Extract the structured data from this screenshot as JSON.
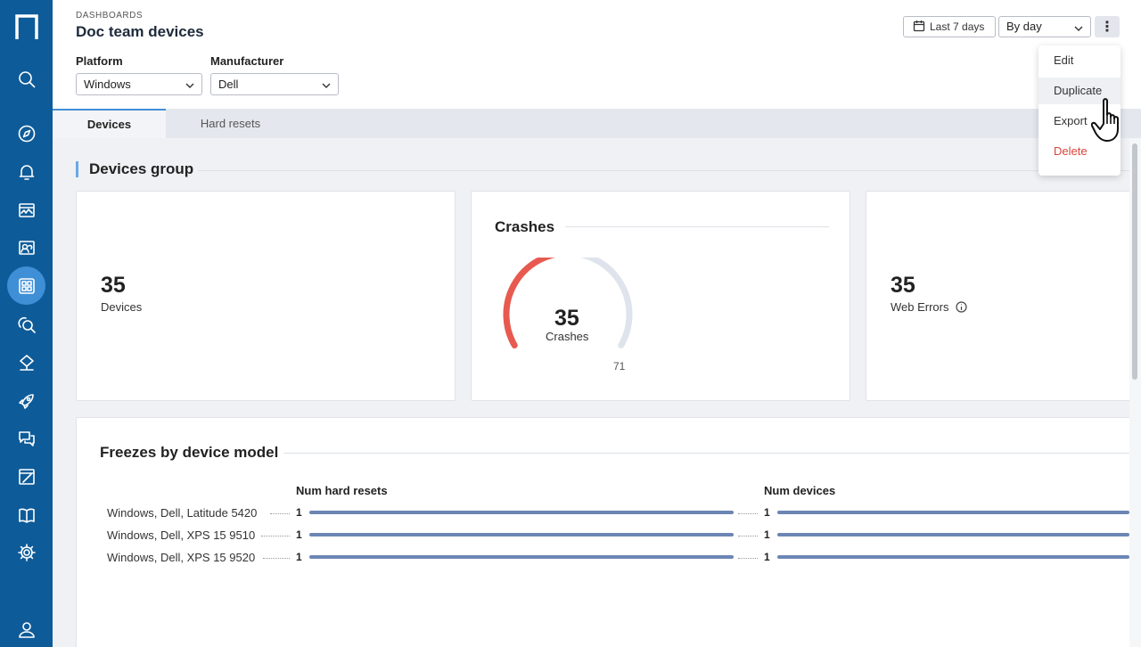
{
  "sidebar": {
    "items": [
      {
        "icon": "search-icon"
      },
      {
        "icon": "compass-icon"
      },
      {
        "icon": "bell-icon"
      },
      {
        "icon": "activity-icon"
      },
      {
        "icon": "users-icon"
      },
      {
        "icon": "dashboard-icon",
        "active": true
      },
      {
        "icon": "search-users-icon"
      },
      {
        "icon": "hierarchy-icon"
      },
      {
        "icon": "rocket-icon"
      },
      {
        "icon": "chat-icon"
      },
      {
        "icon": "edit-icon"
      },
      {
        "icon": "book-icon"
      },
      {
        "icon": "gear-icon"
      },
      {
        "icon": "user-icon"
      }
    ]
  },
  "header": {
    "breadcrumb": "DASHBOARDS",
    "title": "Doc team devices",
    "filters": {
      "platform_label": "Platform",
      "platform_value": "Windows",
      "manufacturer_label": "Manufacturer",
      "manufacturer_value": "Dell"
    },
    "date_range": "Last 7 days",
    "granularity": "By day",
    "more_label": "⋮"
  },
  "tabs": [
    {
      "label": "Devices",
      "active": true
    },
    {
      "label": "Hard resets",
      "active": false
    }
  ],
  "section": {
    "title": "Devices group"
  },
  "cards": {
    "devices": {
      "value": "35",
      "label": "Devices"
    },
    "crashes": {
      "title": "Crashes",
      "value": "35",
      "label": "Crashes",
      "max": "71",
      "fraction": 0.493
    },
    "web_errors": {
      "value": "35",
      "label": "Web Errors"
    }
  },
  "freezes": {
    "title": "Freezes by device model",
    "col1": "Num hard resets",
    "col2": "Num devices",
    "rows": [
      {
        "label": "Windows, Dell, Latitude 5420",
        "hard_resets": "1",
        "devices": "1"
      },
      {
        "label": "Windows, Dell, XPS 15 9510",
        "hard_resets": "1",
        "devices": "1"
      },
      {
        "label": "Windows, Dell, XPS 15 9520",
        "hard_resets": "1",
        "devices": "1"
      }
    ]
  },
  "menu": {
    "edit": "Edit",
    "duplicate": "Duplicate",
    "export": "Export",
    "delete": "Delete"
  },
  "colors": {
    "sidebar": "#0e5b99",
    "accent": "#3f8fd6",
    "gauge_fill": "#e85a4f",
    "gauge_track": "#dfe3ec",
    "bar": "#6c86b4",
    "danger": "#d9453a"
  }
}
